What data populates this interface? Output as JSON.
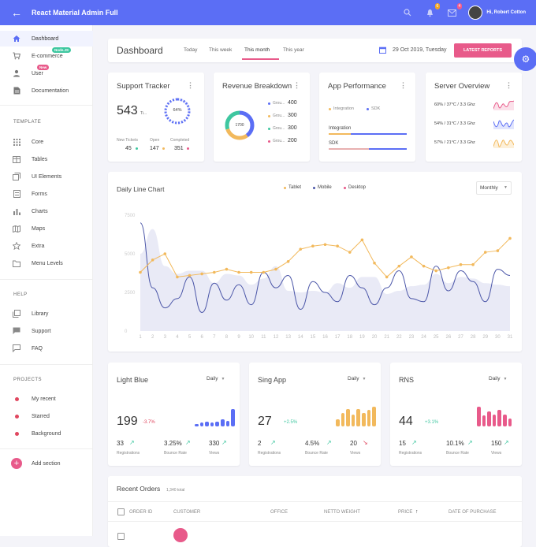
{
  "header": {
    "title": "React Material Admin Full",
    "notif_count": "6",
    "mail_count": "4",
    "user": "Hi, Robert Cotton"
  },
  "sidebar": {
    "items": [
      {
        "label": "Dashboard"
      },
      {
        "label": "E-commerce",
        "badge": "Node.JS"
      },
      {
        "label": "User",
        "badge": "New"
      },
      {
        "label": "Documentation"
      }
    ],
    "template_heading": "TEMPLATE",
    "template": [
      {
        "label": "Core"
      },
      {
        "label": "Tables"
      },
      {
        "label": "UI Elements"
      },
      {
        "label": "Forms"
      },
      {
        "label": "Charts"
      },
      {
        "label": "Maps"
      },
      {
        "label": "Extra"
      },
      {
        "label": "Menu Levels"
      }
    ],
    "help_heading": "HELP",
    "help": [
      {
        "label": "Library"
      },
      {
        "label": "Support"
      },
      {
        "label": "FAQ"
      }
    ],
    "projects_heading": "PROJECTS",
    "projects": [
      {
        "label": "My recent"
      },
      {
        "label": "Starred"
      },
      {
        "label": "Background"
      }
    ],
    "add_section": "Add section"
  },
  "dashbar": {
    "title": "Dashboard",
    "tabs": [
      "Today",
      "This week",
      "This month",
      "This year"
    ],
    "active_tab": 2,
    "date": "29 Oct 2019, Tuesday",
    "button": "LATEST REPORTS"
  },
  "support": {
    "title": "Support Tracker",
    "total": "543",
    "total_label": "Ti...",
    "percent": "64%",
    "stats": [
      {
        "label": "New Tickets",
        "value": "45"
      },
      {
        "label": "Open",
        "value": "147"
      },
      {
        "label": "Completed",
        "value": "351"
      }
    ]
  },
  "revenue": {
    "title": "Revenue Breakdown",
    "center": "1700",
    "legend": [
      {
        "label": "Grou...",
        "value": "400",
        "color": "#5b6ef5"
      },
      {
        "label": "Grou...",
        "value": "300",
        "color": "#f2b95c"
      },
      {
        "label": "Grou...",
        "value": "300",
        "color": "#3ec7a0"
      },
      {
        "label": "Grou...",
        "value": "200",
        "color": "#e85a8a"
      }
    ]
  },
  "performance": {
    "title": "App Performance",
    "legend": [
      "Integration",
      "SDK"
    ],
    "bars": [
      {
        "label": "Integration",
        "level": 0.28
      },
      {
        "label": "SDK",
        "level": 0.52
      }
    ]
  },
  "server": {
    "title": "Server Overview",
    "rows": [
      {
        "text": "60% / 37°C / 3.3 Ghz",
        "color": "#e85a8a"
      },
      {
        "text": "54% / 31°C / 3.3 Ghz",
        "color": "#5b6ef5"
      },
      {
        "text": "57% / 21°C / 3.3 Ghz",
        "color": "#f2b95c"
      }
    ]
  },
  "daily": {
    "title": "Daily Line Chart",
    "legend": [
      "Tablet",
      "Mobile",
      "Desktop"
    ],
    "select": "Monthly"
  },
  "chart_data": {
    "type": "line",
    "title": "Daily Line Chart",
    "x": [
      1,
      2,
      3,
      4,
      5,
      6,
      7,
      8,
      9,
      10,
      11,
      12,
      13,
      14,
      15,
      16,
      17,
      18,
      19,
      20,
      21,
      22,
      23,
      24,
      25,
      26,
      27,
      28,
      29,
      30,
      31
    ],
    "ylim": [
      0,
      7500
    ],
    "yticks": [
      "7500",
      "5000",
      "2500",
      "0"
    ],
    "series": [
      {
        "name": "Tablet",
        "color": "#f2b95c",
        "values": [
          3800,
          4600,
          5000,
          3500,
          3600,
          3700,
          3800,
          4000,
          3800,
          3800,
          3800,
          4000,
          4500,
          5300,
          5500,
          5600,
          5500,
          5100,
          5900,
          4400,
          3500,
          4200,
          4800,
          4200,
          3900,
          4100,
          4300,
          4300,
          5100,
          5200,
          6000
        ]
      },
      {
        "name": "Mobile",
        "color": "#4b56a8",
        "values": [
          7000,
          2800,
          1500,
          2100,
          3500,
          1200,
          3100,
          2000,
          3000,
          1700,
          3800,
          2800,
          3600,
          1400,
          3200,
          2500,
          1900,
          3600,
          2800,
          1700,
          2800,
          3900,
          2100,
          1900,
          4200,
          2600,
          3900,
          3200,
          1900,
          4000,
          3600
        ]
      },
      {
        "name": "Desktop",
        "color": "#e9eaf6",
        "values": [
          5000,
          6600,
          4200,
          3700,
          3900,
          3900,
          3100,
          3700,
          3600,
          3000,
          3400,
          4200,
          2600,
          2500,
          2600,
          2500,
          3100,
          2800,
          3500,
          3500,
          2400,
          2600,
          2900,
          3000,
          3700,
          3100,
          3500,
          3400,
          3100,
          3000,
          2900
        ]
      }
    ]
  },
  "stats": [
    {
      "title": "Light Blue",
      "select": "Daily",
      "value": "199",
      "change": "-3.7%",
      "change_color": "#e0475f",
      "color": "#5b6ef5",
      "bars": [
        0.12,
        0.2,
        0.25,
        0.22,
        0.25,
        0.35,
        0.3,
        0.9
      ],
      "metrics": [
        {
          "value": "33",
          "label": "Registrations",
          "trend": "up"
        },
        {
          "value": "3.25%",
          "label": "Bounce Rate",
          "trend": "up"
        },
        {
          "value": "330",
          "label": "Views",
          "trend": "up"
        }
      ]
    },
    {
      "title": "Sing App",
      "select": "Daily",
      "value": "27",
      "change": "+2.5%",
      "change_color": "#3ec7a0",
      "color": "#f2b95c",
      "bars": [
        0.35,
        0.7,
        0.9,
        0.6,
        0.9,
        0.7,
        0.85,
        1.0
      ],
      "metrics": [
        {
          "value": "2",
          "label": "Registrations",
          "trend": "up"
        },
        {
          "value": "4.5%",
          "label": "Bounce Rate",
          "trend": "up"
        },
        {
          "value": "20",
          "label": "Views",
          "trend": "down"
        }
      ]
    },
    {
      "title": "RNS",
      "select": "Daily",
      "value": "44",
      "change": "+3.1%",
      "change_color": "#3ec7a0",
      "color": "#e85a8a",
      "bars": [
        1.0,
        0.55,
        0.75,
        0.6,
        0.85,
        0.6,
        0.4
      ],
      "metrics": [
        {
          "value": "15",
          "label": "Registrations",
          "trend": "up"
        },
        {
          "value": "10.1%",
          "label": "Bounce Rate",
          "trend": "up"
        },
        {
          "value": "150",
          "label": "Views",
          "trend": "up"
        }
      ]
    }
  ],
  "orders": {
    "title": "Recent Orders",
    "total": "1,340 total",
    "columns": [
      "ORDER ID",
      "CUSTOMER",
      "OFFICE",
      "NETTO WEIGHT",
      "PRICE",
      "DATE OF PURCHASE"
    ]
  }
}
